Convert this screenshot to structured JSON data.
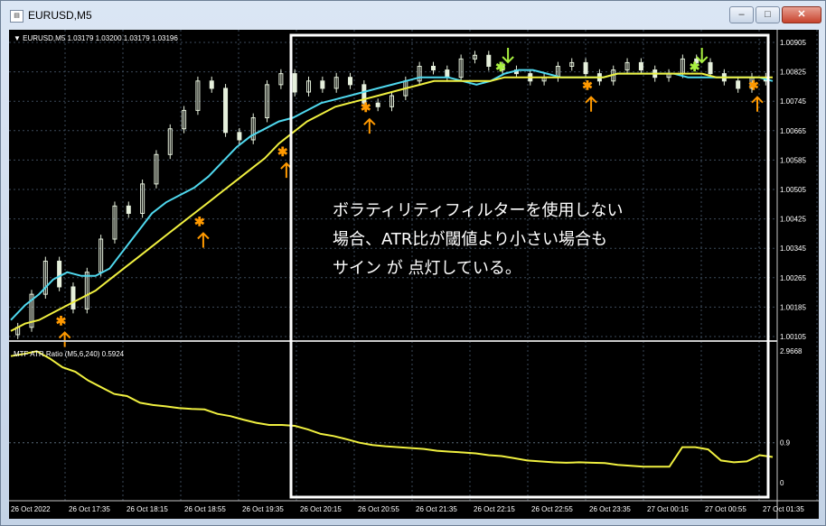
{
  "window": {
    "title": "EURUSD,M5",
    "buttons": {
      "minimize": "‒",
      "maximize": "□",
      "close": "✕"
    }
  },
  "main_panel": {
    "header": "▼ EURUSD,M5  1.03179 1.03200 1.03179 1.03196",
    "price_labels": [
      "1.00905",
      "1.00825",
      "1.00745",
      "1.00665",
      "1.00585",
      "1.00505",
      "1.00425",
      "1.00345",
      "1.00265",
      "1.00185",
      "1.00105"
    ],
    "annotation_lines": [
      "ボラティリティフィルターを使用しない",
      "場合、ATR比が閾値より小さい場合も",
      "サイン が 点灯している。"
    ]
  },
  "sub_panel": {
    "header": "MTF ATR Ratio  (M5,6,240) 0.5924",
    "labels": [
      "2.9668",
      "0.9",
      "0"
    ]
  },
  "time_labels": [
    "26 Oct 2022",
    "26 Oct 17:35",
    "26 Oct 18:15",
    "26 Oct 18:55",
    "26 Oct 19:35",
    "26 Oct 20:15",
    "26 Oct 20:55",
    "26 Oct 21:35",
    "26 Oct 22:15",
    "26 Oct 22:55",
    "26 Oct 23:35",
    "27 Oct 00:15",
    "27 Oct 00:55",
    "27 Oct 01:35"
  ],
  "colors": {
    "background": "#000000",
    "candle": "#e6f0dc",
    "fast_ma": "#4fd8ee",
    "slow_ma": "#f0f040",
    "buy_signal": "#ff9900",
    "sell_signal": "#a8f040",
    "atr_line": "#f0f040",
    "highlight_box": "#ffffff"
  },
  "chart_data": {
    "type": "line",
    "price_y_range": [
      1.00105,
      1.00905
    ],
    "atr_y_range": [
      0,
      2.9668
    ],
    "atr_threshold": 0.9,
    "grid": true,
    "fast_ma": [
      1.0015,
      1.0019,
      1.0022,
      1.0026,
      1.0028,
      1.0027,
      1.0027,
      1.0029,
      1.0034,
      1.0039,
      1.0044,
      1.0047,
      1.0049,
      1.0051,
      1.0054,
      1.0058,
      1.0062,
      1.0065,
      1.0067,
      1.0069,
      1.007,
      1.0072,
      1.0074,
      1.0075,
      1.0076,
      1.0077,
      1.0078,
      1.0079,
      1.008,
      1.0081,
      1.0081,
      1.0081,
      1.008,
      1.0079,
      1.008,
      1.0082,
      1.0083,
      1.0083,
      1.0082,
      1.0081,
      1.0081,
      1.0081,
      1.0081,
      1.0082,
      1.0082,
      1.0082,
      1.0082,
      1.0082,
      1.0081,
      1.0081,
      1.0081,
      1.0081,
      1.0081,
      1.0081,
      1.008
    ],
    "slow_ma": [
      1.0012,
      1.0014,
      1.0015,
      1.0017,
      1.0019,
      1.0021,
      1.0023,
      1.0026,
      1.0029,
      1.0032,
      1.0035,
      1.0038,
      1.0041,
      1.0044,
      1.0047,
      1.005,
      1.0053,
      1.0056,
      1.0059,
      1.0063,
      1.0066,
      1.0069,
      1.0071,
      1.0073,
      1.0074,
      1.0075,
      1.0076,
      1.0077,
      1.0078,
      1.0079,
      1.008,
      1.008,
      1.008,
      1.008,
      1.008,
      1.0081,
      1.0081,
      1.0081,
      1.0081,
      1.0081,
      1.0081,
      1.0081,
      1.0081,
      1.0082,
      1.0082,
      1.0082,
      1.0082,
      1.0082,
      1.0082,
      1.0082,
      1.0081,
      1.0081,
      1.0081,
      1.0081,
      1.0081
    ],
    "candles_close": [
      1.0013,
      1.0022,
      1.0031,
      1.0024,
      1.0018,
      1.0028,
      1.0037,
      1.0046,
      1.0044,
      1.0052,
      1.006,
      1.0067,
      1.0072,
      1.008,
      1.0078,
      1.0066,
      1.0064,
      1.007,
      1.0079,
      1.0082,
      1.0077,
      1.008,
      1.0078,
      1.0081,
      1.0079,
      1.0074,
      1.0073,
      1.0076,
      1.008,
      1.0084,
      1.0083,
      1.0081,
      1.0086,
      1.0087,
      1.0084,
      1.0083,
      1.0082,
      1.008,
      1.0081,
      1.0084,
      1.0085,
      1.0082,
      1.008,
      1.0083,
      1.0085,
      1.0083,
      1.0081,
      1.0082,
      1.0086,
      1.0085,
      1.0082,
      1.008,
      1.0078,
      1.0081,
      1.008
    ],
    "buy_signals": [
      3,
      14,
      21,
      27,
      45,
      58
    ],
    "sell_signals": [
      38,
      53
    ],
    "atr_ratio": [
      2.85,
      2.9,
      2.96,
      2.8,
      2.6,
      2.5,
      2.3,
      2.15,
      2.0,
      1.95,
      1.8,
      1.75,
      1.72,
      1.68,
      1.66,
      1.65,
      1.55,
      1.5,
      1.42,
      1.35,
      1.3,
      1.3,
      1.28,
      1.2,
      1.1,
      1.05,
      0.98,
      0.9,
      0.85,
      0.82,
      0.8,
      0.78,
      0.76,
      0.72,
      0.7,
      0.68,
      0.66,
      0.62,
      0.6,
      0.55,
      0.5,
      0.48,
      0.46,
      0.45,
      0.46,
      0.45,
      0.44,
      0.4,
      0.38,
      0.36,
      0.36,
      0.36,
      0.8,
      0.8,
      0.75,
      0.5,
      0.46,
      0.48,
      0.62,
      0.58
    ]
  }
}
